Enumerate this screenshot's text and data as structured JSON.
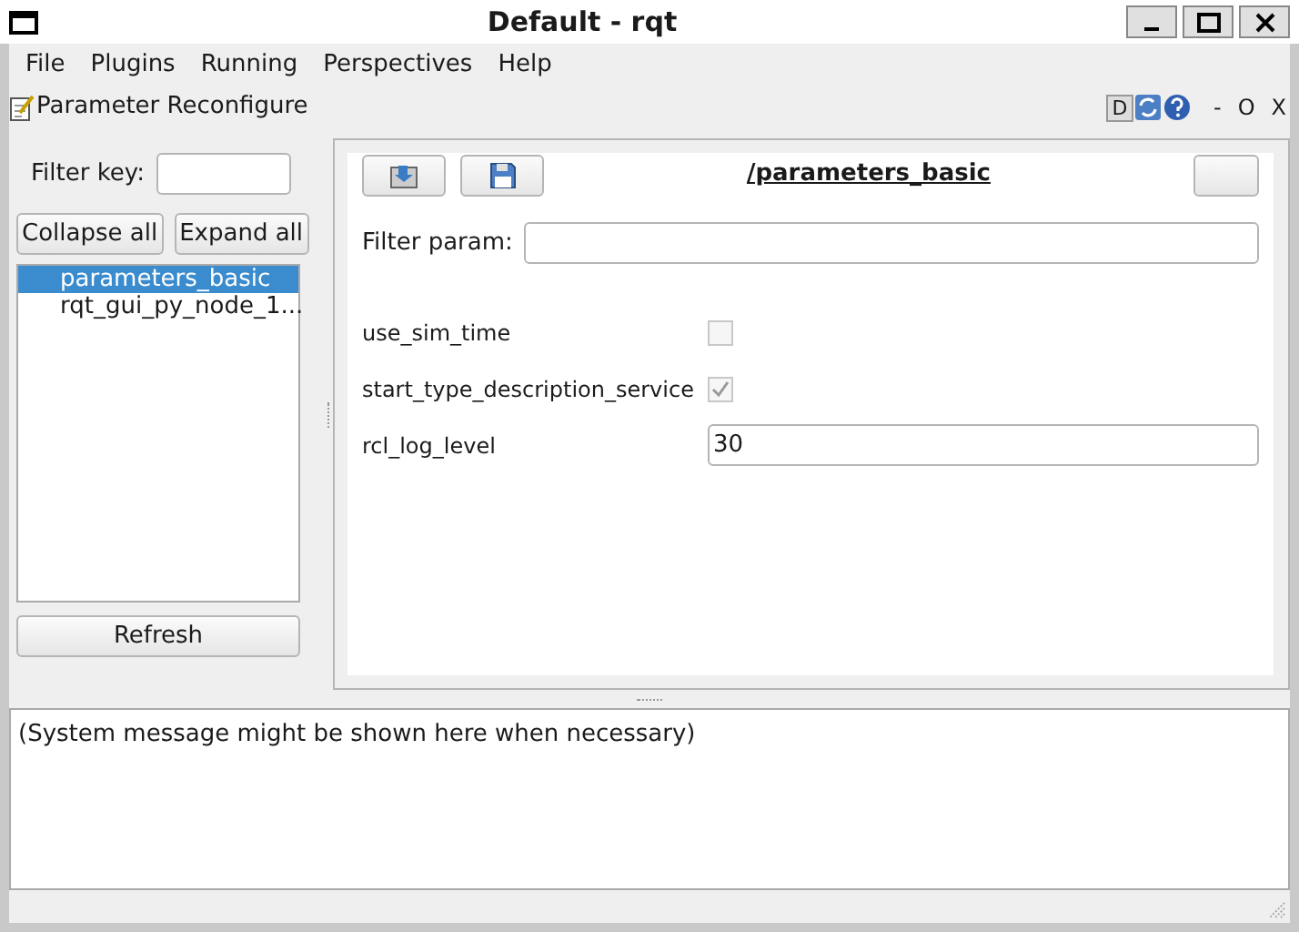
{
  "window": {
    "title": "Default - rqt"
  },
  "menu": [
    "File",
    "Plugins",
    "Running",
    "Perspectives",
    "Help"
  ],
  "dock": {
    "title": "Parameter Reconfigure",
    "d_button": "D",
    "controls": [
      "-",
      "O",
      "X"
    ]
  },
  "left": {
    "filter_label": "Filter key:",
    "buttons": [
      "Collapse all",
      "Expand all"
    ],
    "nodes": [
      {
        "label": "parameters_basic",
        "selected": true
      },
      {
        "label": "rqt_gui_py_node_1...",
        "selected": false
      }
    ],
    "refresh": "Refresh"
  },
  "editor": {
    "node_title": "/parameters_basic",
    "filter_label": "Filter param:",
    "params": [
      {
        "name": "use_sim_time",
        "kind": "bool",
        "checked": false
      },
      {
        "name": "start_type_description_service",
        "kind": "bool",
        "checked": true
      },
      {
        "name": "rcl_log_level",
        "kind": "text",
        "value": "30"
      }
    ]
  },
  "console": {
    "message": "(System message might be shown here when necessary)"
  }
}
